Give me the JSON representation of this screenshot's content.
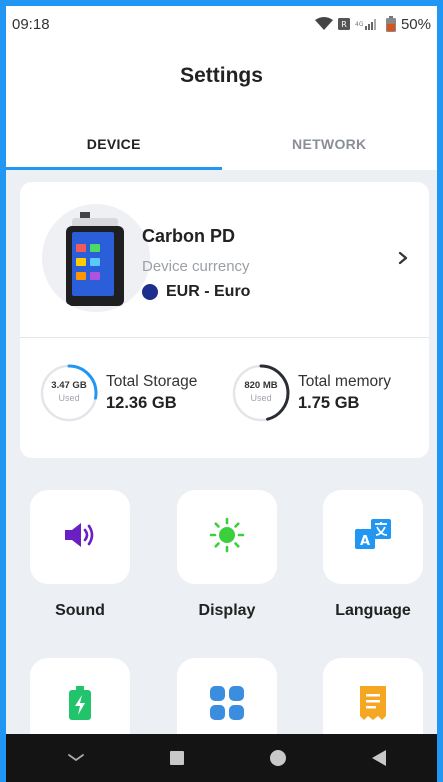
{
  "status_bar": {
    "time": "09:18",
    "battery": "50%",
    "icons": [
      "wifi-icon",
      "notification-icon",
      "signal-icon",
      "battery-icon"
    ]
  },
  "header": {
    "title": "Settings"
  },
  "tabs": [
    {
      "label": "DEVICE",
      "active": true
    },
    {
      "label": "NETWORK",
      "active": false
    }
  ],
  "device": {
    "name": "Carbon PD",
    "currency_label": "Device currency",
    "currency_value": "EUR - Euro"
  },
  "storage": {
    "total_storage": {
      "label": "Total Storage",
      "value": "12.36 GB",
      "used": "3.47 GB",
      "used_label": "Used",
      "fraction": 0.28
    },
    "total_memory": {
      "label": "Total memory",
      "value": "1.75 GB",
      "used": "820 MB",
      "used_label": "Used",
      "fraction": 0.46
    }
  },
  "tiles": [
    {
      "label": "Sound",
      "icon": "speaker-icon"
    },
    {
      "label": "Display",
      "icon": "brightness-icon"
    },
    {
      "label": "Language",
      "icon": "translate-icon"
    },
    {
      "label": "",
      "icon": "battery-charging-icon"
    },
    {
      "label": "",
      "icon": "apps-grid-icon"
    },
    {
      "label": "",
      "icon": "receipt-icon"
    }
  ],
  "colors": {
    "accent": "#2196f3",
    "sound": "#6a1fc2",
    "display": "#3ccf3c",
    "language": "#2196f3",
    "battery": "#21c46a",
    "apps": "#3b8de0",
    "receipt": "#f5a623",
    "background": "#eceff3"
  },
  "nav": [
    "back-icon",
    "home-icon",
    "recents-icon",
    "keyboard-hide-icon"
  ]
}
